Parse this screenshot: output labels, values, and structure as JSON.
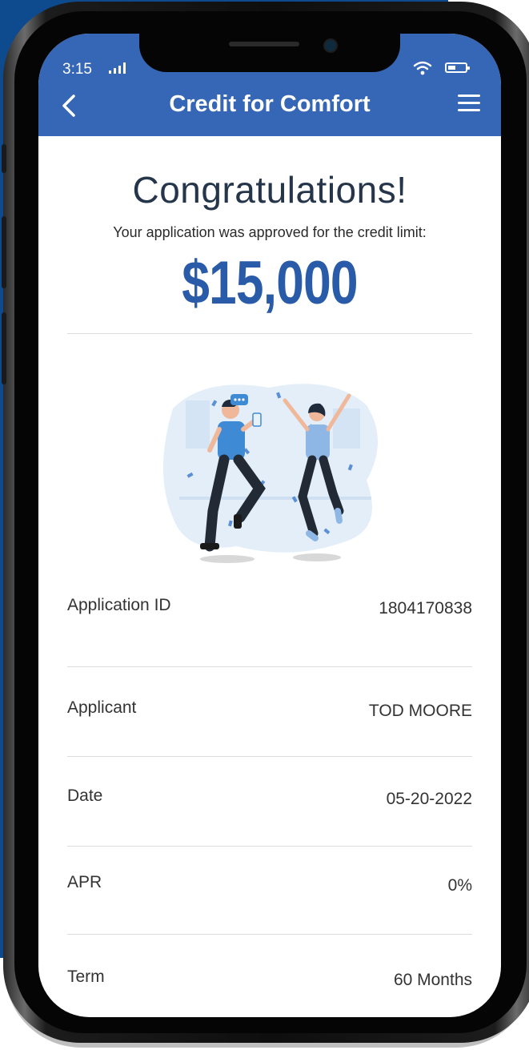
{
  "status_bar": {
    "time": "3:15"
  },
  "app_bar": {
    "title": "Credit for Comfort",
    "background_color": "#3567b6"
  },
  "approval": {
    "heading": "Congratulations!",
    "message": "Your application was approved for the credit limit:",
    "credit_limit": "$15,000",
    "amount_color": "#2a5ba8"
  },
  "details": [
    {
      "label": "Application ID",
      "value": "1804170838"
    },
    {
      "label": "Applicant",
      "value": "TOD MOORE"
    },
    {
      "label": "Date",
      "value": "05-20-2022"
    },
    {
      "label": "APR",
      "value": "0%"
    },
    {
      "label": "Term",
      "value": "60 Months"
    }
  ],
  "icons": {
    "back": "chevron-left-icon",
    "menu": "hamburger-menu-icon",
    "signal": "cellular-signal-icon",
    "wifi": "wifi-icon",
    "battery": "battery-icon"
  }
}
